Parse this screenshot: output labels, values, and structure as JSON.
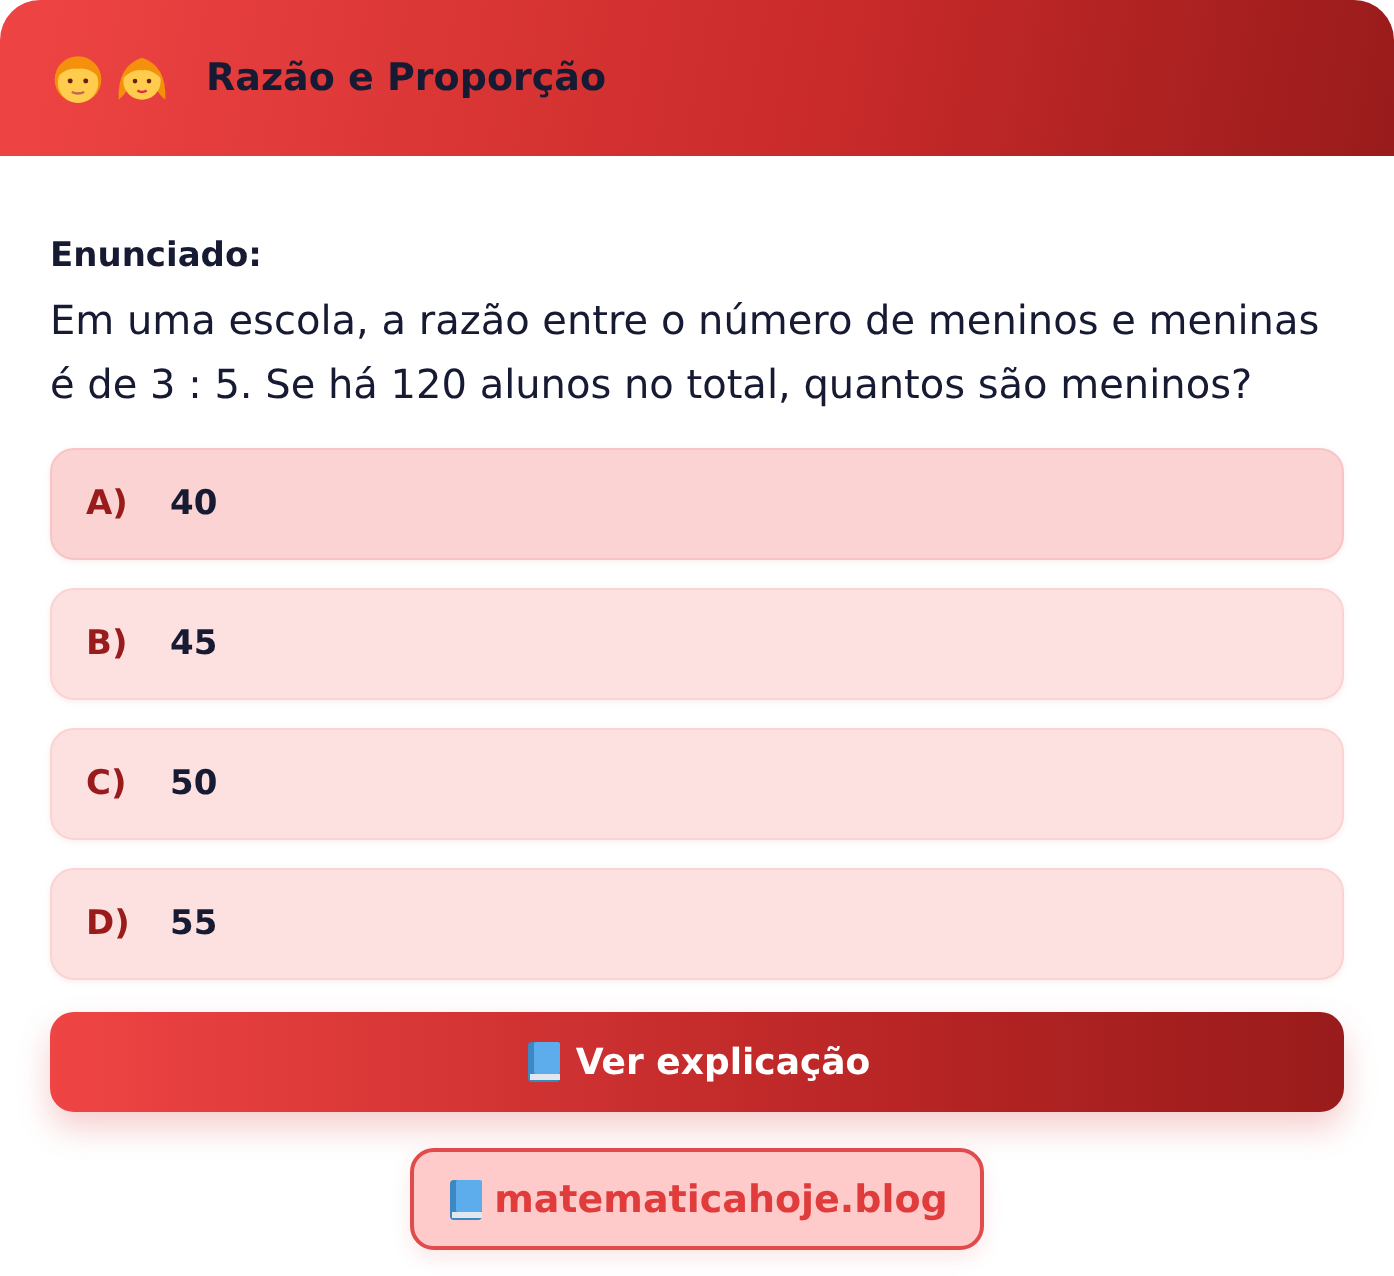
{
  "header": {
    "title": "Razão e Proporção"
  },
  "question": {
    "label": "Enunciado:",
    "text": "Em uma escola, a razão entre o número de meninos e meninas é de 3 : 5. Se há 120 alunos no total, quantos são meninos?"
  },
  "options": [
    {
      "letter": "A)",
      "value": "40",
      "selected": true
    },
    {
      "letter": "B)",
      "value": "45",
      "selected": false
    },
    {
      "letter": "C)",
      "value": "50",
      "selected": false
    },
    {
      "letter": "D)",
      "value": "55",
      "selected": false
    }
  ],
  "explain_button": {
    "label": "Ver explicação"
  },
  "site_link": {
    "label": "matematicahoje.blog"
  }
}
